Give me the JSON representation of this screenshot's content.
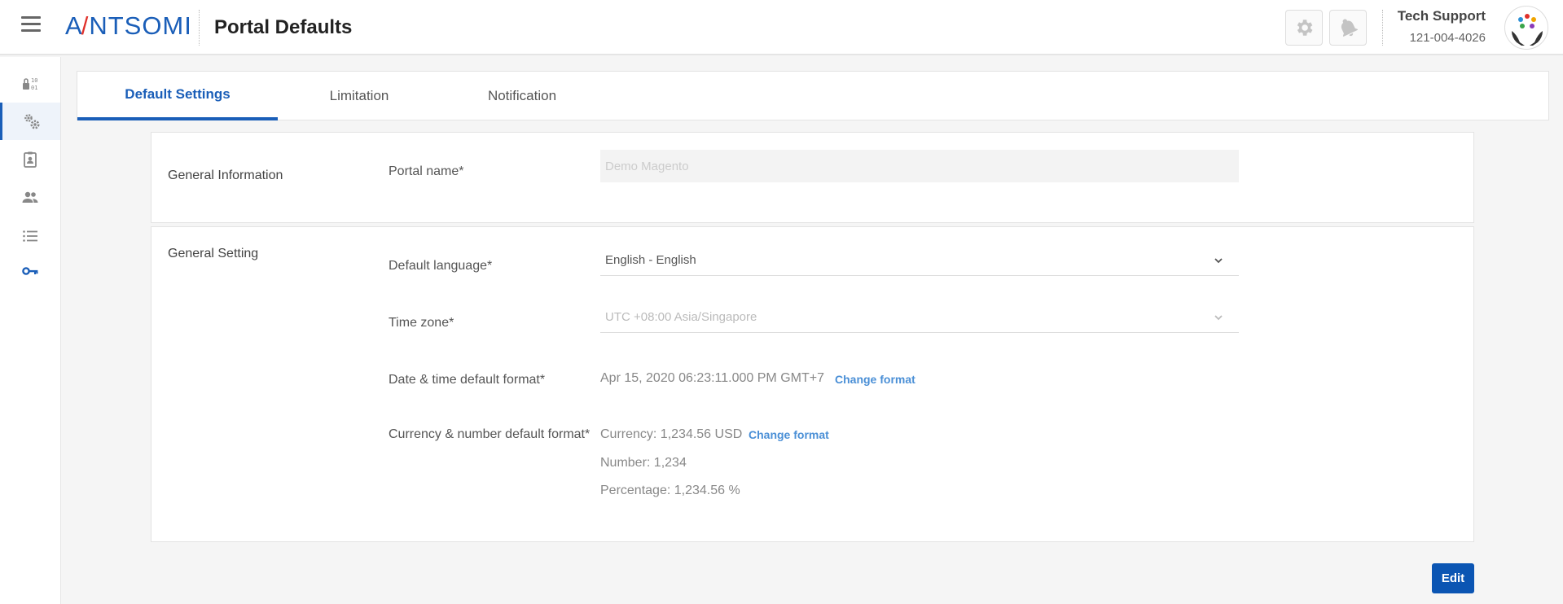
{
  "header": {
    "logo_text": "ANTSOMI",
    "title": "Portal Defaults",
    "settings_icon": "gear-icon",
    "notification_icon": "bell-icon",
    "user_name": "Tech Support",
    "user_phone": "121-004-4026"
  },
  "sidebar": {
    "items": [
      {
        "icon": "binary-lock-icon"
      },
      {
        "icon": "gears-icon",
        "active": true
      },
      {
        "icon": "clipboard-user-icon"
      },
      {
        "icon": "users-icon"
      },
      {
        "icon": "list-icon"
      },
      {
        "icon": "key-icon"
      }
    ]
  },
  "tabs": [
    {
      "label": "Default Settings",
      "active": true
    },
    {
      "label": "Limitation"
    },
    {
      "label": "Notification"
    }
  ],
  "general_information": {
    "section_label": "General Information",
    "portal_name_label": "Portal name*",
    "portal_name_value": "Demo Magento"
  },
  "general_setting": {
    "section_label": "General Setting",
    "default_language_label": "Default language*",
    "default_language_value": "English - English",
    "time_zone_label": "Time zone*",
    "time_zone_value": "UTC +08:00 Asia/Singapore",
    "datetime_label": "Date & time default format*",
    "datetime_value": "Apr 15, 2020 06:23:11.000 PM GMT+7",
    "datetime_change": "Change format",
    "currency_label": "Currency & number default format*",
    "currency_value": "Currency: 1,234.56 USD",
    "currency_change": "Change format",
    "number_value": "Number: 1,234",
    "percentage_value": "Percentage: 1,234.56 %"
  },
  "actions": {
    "edit_label": "Edit"
  },
  "colors": {
    "brand": "#1a5eb8",
    "accent": "#e0312b",
    "link": "#4a8fd6",
    "button": "#0b55b3"
  }
}
